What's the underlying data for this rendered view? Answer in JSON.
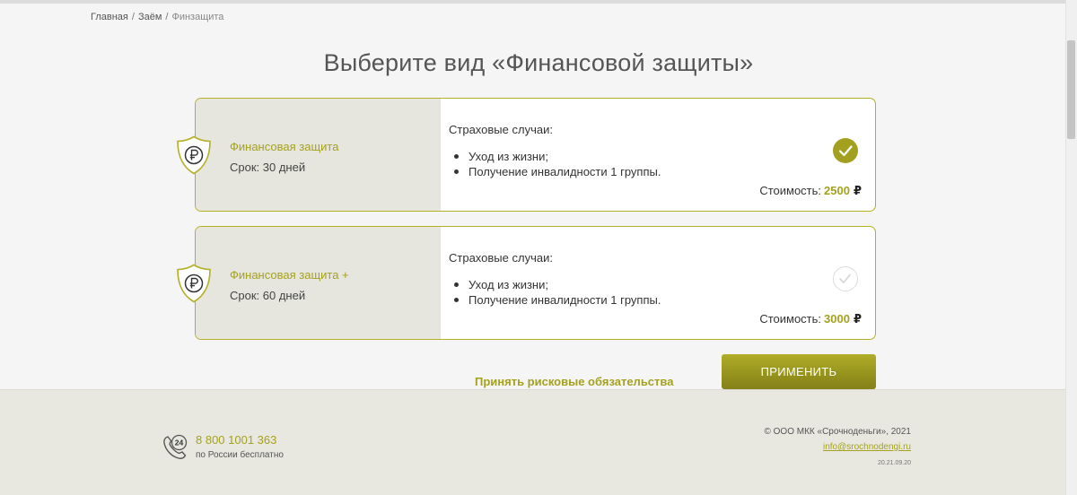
{
  "breadcrumb": {
    "items": [
      "Главная",
      "Заём",
      "Финзащита"
    ],
    "separator": "/"
  },
  "page_title": "Выберите вид «Финансовой защиты»",
  "plans": [
    {
      "name": "Финансовая защита",
      "term": "Срок: 30 дней",
      "cases_title": "Страховые случаи:",
      "cases": [
        "Уход из жизни;",
        "Получение инвалидности 1 группы."
      ],
      "price_label": "Стоимость:",
      "price": "2500",
      "currency": "₽",
      "selected": true,
      "icon": "shield-ruble-icon"
    },
    {
      "name": "Финансовая защита +",
      "term": "Срок: 60 дней",
      "cases_title": "Страховые случаи:",
      "cases": [
        "Уход из жизни;",
        "Получение инвалидности 1 группы."
      ],
      "price_label": "Стоимость:",
      "price": "3000",
      "currency": "₽",
      "selected": false,
      "icon": "shield-ruble-icon"
    }
  ],
  "actions": {
    "accept_link": "Принять рисковые обязательства",
    "apply_button": "ПРИМЕНИТЬ"
  },
  "footer": {
    "phone_icon": "phone-24-icon",
    "phone_badge": "24",
    "phone": "8 800 1001 363",
    "phone_note": "по России бесплатно",
    "copyright": "© ООО МКК «Срочноденьги», 2021",
    "email": "info@srochnodengi.ru",
    "version": "20.21.09.20"
  },
  "colors": {
    "accent": "#a5a11f",
    "card_border": "#b3b026",
    "card_left_bg": "#e6e6df",
    "footer_bg": "#e8e8e1",
    "button_top": "#b0ad28",
    "button_bottom": "#838017"
  }
}
